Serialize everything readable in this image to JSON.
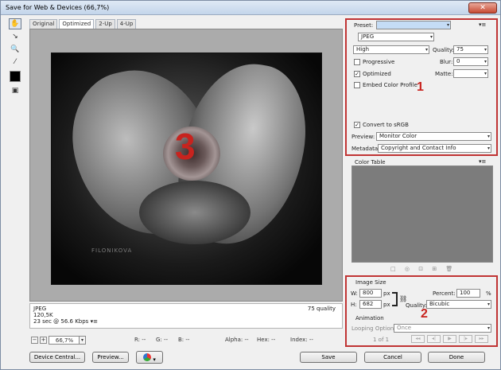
{
  "window": {
    "title": "Save for Web & Devices (66,7%)",
    "close_glyph": "✕"
  },
  "tools": [
    {
      "name": "hand-tool-icon",
      "glyph": "✋"
    },
    {
      "name": "slice-select-tool-icon",
      "glyph": "↘"
    },
    {
      "name": "zoom-tool-icon",
      "glyph": "🔍"
    },
    {
      "name": "eyedropper-tool-icon",
      "glyph": "⁄"
    }
  ],
  "tabs": [
    "Original",
    "Optimized",
    "2-Up",
    "4-Up"
  ],
  "image": {
    "watermark": "FILONIKOVA",
    "overlay_number": "3"
  },
  "info": {
    "format": "JPEG",
    "size": "120,5K",
    "speed": "23 sec @ 56.6 Kbps",
    "menu_glyph": "▾≡",
    "quality": "75 quality"
  },
  "status": {
    "zoom": "66,7%",
    "r": "R: --",
    "g": "G: --",
    "b": "B: --",
    "alpha": "Alpha: --",
    "hex": "Hex: --",
    "index": "Index: --"
  },
  "buttons": {
    "device_central": "Device Central...",
    "preview": "Preview...",
    "save": "Save",
    "cancel": "Cancel",
    "done": "Done"
  },
  "settings": {
    "preset_label": "Preset:",
    "preset_value": "",
    "format": "JPEG",
    "compression": "High",
    "quality_label": "Quality:",
    "quality_value": "75",
    "progressive_label": "Progressive",
    "blur_label": "Blur:",
    "blur_value": "0",
    "optimized_label": "Optimized",
    "matte_label": "Matte:",
    "embed_profile_label": "Embed Color Profile",
    "convert_srgb_label": "Convert to sRGB",
    "preview_label": "Preview:",
    "preview_value": "Monitor Color",
    "metadata_label": "Metadata:",
    "metadata_value": "Copyright and Contact Info",
    "section_number": "1"
  },
  "color_table": {
    "label": "Color Table",
    "icons": [
      "□",
      "◎",
      "⊡",
      "⊞",
      "🗑"
    ]
  },
  "image_size": {
    "label": "Image Size",
    "w_label": "W:",
    "w_value": "800",
    "h_label": "H:",
    "h_value": "682",
    "unit": "px",
    "percent_label": "Percent:",
    "percent_value": "100",
    "percent_unit": "%",
    "quality_label": "Quality:",
    "quality_value": "Bicubic",
    "section_number": "2"
  },
  "animation": {
    "label": "Animation",
    "looping_label": "Looping Options:",
    "looping_value": "Once",
    "frame_counter": "1 of 1",
    "nav": [
      "◂◂",
      "◂|",
      "▶",
      "|▸",
      "▸▸"
    ]
  },
  "colors": {
    "highlight": "#c03434",
    "accent_number": "#c8231e",
    "preset_field": "#c5dcf5"
  }
}
